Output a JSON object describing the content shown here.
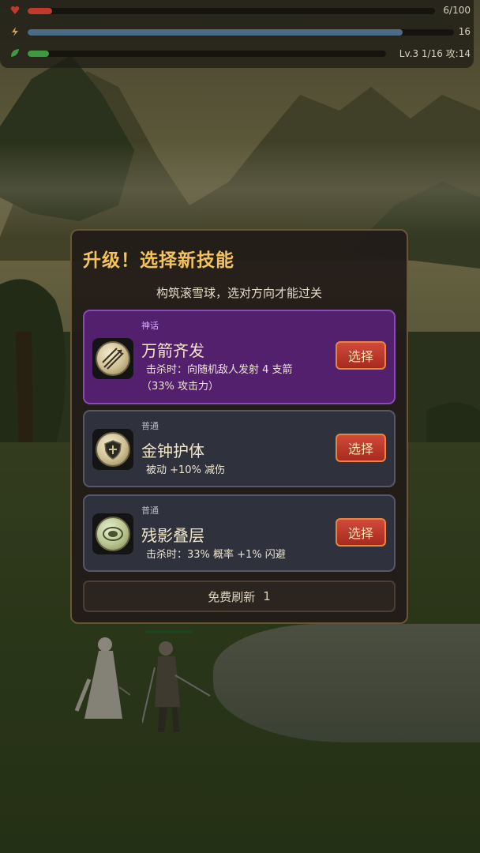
{
  "hud": {
    "hp": {
      "text": "6/100",
      "fraction": 0.06,
      "color": "#c0392b"
    },
    "energy": {
      "text": "16",
      "fraction": 0.88,
      "color": "#4a6a86"
    },
    "exp": {
      "text": "Lv.3  1/16  攻:14",
      "fraction": 0.06,
      "color": "#3e9a3e"
    }
  },
  "dialog": {
    "title": "升级！选择新技能",
    "subtitle": "构筑滚雪球，选对方向才能过关",
    "cards": [
      {
        "rarity": "神话",
        "name": "万箭齐发",
        "desc1": "击杀时：向随机敌人发射 4 支箭",
        "desc2": "（33% 攻击力）",
        "button": "选择",
        "icon": "arrows-icon"
      },
      {
        "rarity": "普通",
        "name": "金钟护体",
        "desc1": "被动 +10% 减伤",
        "desc2": "",
        "button": "选择",
        "icon": "shield-icon"
      },
      {
        "rarity": "普通",
        "name": "残影叠层",
        "desc1": "击杀时：33% 概率 +1% 闪避",
        "desc2": "",
        "button": "选择",
        "icon": "afterimage-icon"
      }
    ],
    "refresh": {
      "label": "免费刷新",
      "count": "1"
    }
  }
}
